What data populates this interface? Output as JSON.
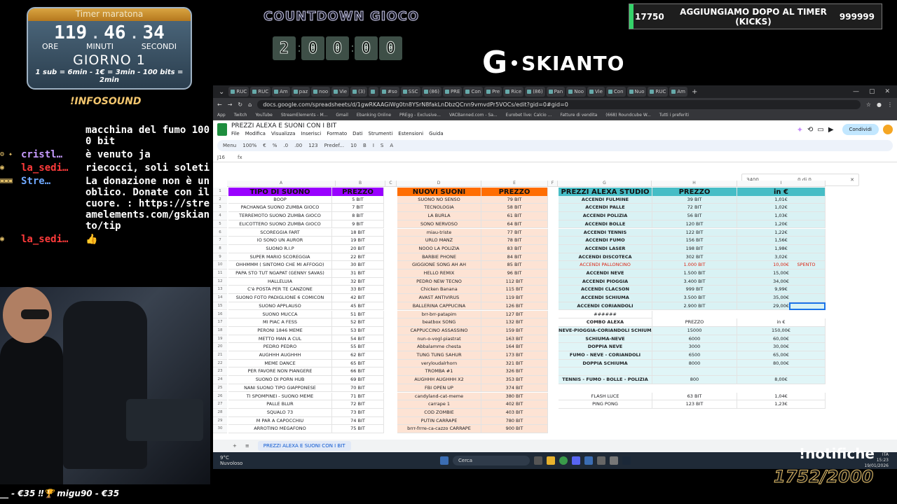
{
  "timer": {
    "title": "Timer maratona",
    "hours": "119",
    "minutes": "46",
    "seconds": "34",
    "unit_hours": "ORE",
    "unit_minutes": "MINUTI",
    "unit_seconds": "SECONDI",
    "day": "GIORNO 1",
    "rates": "1 sub = 6min - 1€ = 3min - 100 bits = 2min"
  },
  "infosound": "!INFOSOUND",
  "chat": [
    {
      "badges": "",
      "user": "",
      "color": "#ffffff",
      "msg": "macchina del fumo 1000 bit"
    },
    {
      "badges": "⚙ ✦",
      "user": "cristl…",
      "color": "#c79bff",
      "msg": "è venuto ja"
    },
    {
      "badges": "◉",
      "user": "la_sedi…",
      "color": "#ff3b3b",
      "msg": "riecocci, soli soleti"
    },
    {
      "badges": "▣▣▣",
      "user": "Stre…",
      "color": "#6fa8ff",
      "msg": "La donazione non è un oblico. Donate con il cuore. : https://streamelements.com/gskianto/tip"
    },
    {
      "badges": "◉",
      "user": "la_sedi…",
      "color": "#ff3b3b",
      "msg": "👍"
    }
  ],
  "donations": "__ - €35     ‼🏆 migu90 - €35",
  "countdown": {
    "title": "COUNTDOWN GIOCO",
    "digits": [
      "2",
      "0",
      "0",
      "0",
      "0"
    ]
  },
  "logo": {
    "letter": "G",
    "name": "SKIANTO"
  },
  "goal": {
    "current": "17750",
    "label": "AGGIUNGIAMO DOPO AL TIMER (KICKS)",
    "max": "999999",
    "progress": 0.0178
  },
  "notifiche": "!notifiche",
  "subcount": "1752/2000",
  "browser": {
    "tabs": [
      "RUC",
      "RUC",
      "Am",
      "paz",
      "noo",
      "Vie",
      "(3)",
      "",
      "#so",
      "SSC",
      "(86)",
      "PRE",
      "Con",
      "Pre",
      "Rice",
      "(86)",
      "Pan",
      "Noo",
      "Vie",
      "Con",
      "Nuo",
      "RUC",
      "Am"
    ],
    "url": "docs.google.com/spreadsheets/d/1gwRKAAGiWg0tn8YSrN8fakLnDbzQCnn9vmvdPr5VOCs/edit?gid=0#gid=0",
    "bookmarks": [
      "App",
      "Twitch",
      "YouTube",
      "StreamElements - M...",
      "Gmail",
      "Ebanking Online",
      "PREgg - Exclusive...",
      "VACBanned.com - Sa...",
      "Eurobet live: Calcio ...",
      "Fatture di vendita",
      "(668) Roundcube W...",
      "Tutti i preferiti"
    ],
    "doc_title": "PREZZI ALEXA E SUONI CON I BIT",
    "menu": [
      "File",
      "Modifica",
      "Visualizza",
      "Inserisci",
      "Formato",
      "Dati",
      "Strumenti",
      "Estensioni",
      "Guida"
    ],
    "share": "Condividi",
    "toolbar": [
      "Menu",
      "100%",
      "€",
      "%",
      ".0",
      ".00",
      "123",
      "Predef...",
      "10",
      "B",
      "I",
      "S",
      "A"
    ],
    "cell_ref": "J16",
    "find_value": "3400",
    "find_count": "0 di 0",
    "columns": [
      "A",
      "B",
      "C",
      "D",
      "E",
      "F",
      "G",
      "H",
      "I"
    ],
    "sheet_tab": "PREZZI ALEXA E SUONI CON I BIT"
  },
  "sheet": {
    "hdr1": {
      "a": "TIPO DI SUONO",
      "b": "PREZZO",
      "color": "#9900ff"
    },
    "hdr2": {
      "a": "NUOVI SUONI",
      "b": "PREZZO",
      "color": "#ff6d01"
    },
    "hdr3": {
      "a": "PREZZI ALEXA STUDIO",
      "b": "PREZZO",
      "c": "in €",
      "color": "#46bdc6"
    },
    "col1": [
      [
        "BOOP",
        "5 BIT"
      ],
      [
        "PACHANGA SUONO ZUMBA GIOCO",
        "7 BIT"
      ],
      [
        "TERREMOTO SUONO ZUMBA GIOCO",
        "8 BIT"
      ],
      [
        "ELICOTTERO SUONO ZUMBA GIOCO",
        "9 BIT"
      ],
      [
        "SCOREGGIA FART",
        "18 BIT"
      ],
      [
        "IO SONO UN AUROR",
        "19 BIT"
      ],
      [
        "SUONO R.I.P",
        "20 BIT"
      ],
      [
        "SUPER MARIO SCOREGGIA",
        "22 BIT"
      ],
      [
        "OHHMMM  ( SINTOMO CHE MI AFFOGO)",
        "30 BIT"
      ],
      [
        "PAPA STO TUT NGAPAT (GENNY SAVAS)",
        "31 BIT"
      ],
      [
        "HALLELUIA",
        "32 BIT"
      ],
      [
        "C'è POSTA PER TE CANZONE",
        "33 BIT"
      ],
      [
        "SUONO FOTO PADIGLIONE 6 COMICON",
        "42 BIT"
      ],
      [
        "SUONO APPLAUSO",
        "45 BIT"
      ],
      [
        "SUONO MUCCA",
        "51 BIT"
      ],
      [
        "MI PIAC A FESS",
        "52 BIT"
      ],
      [
        "PERONI 1846 MEME",
        "53 BIT"
      ],
      [
        "METTO MAN A CUL",
        "54 BIT"
      ],
      [
        "PEDRO PEDRO",
        "55 BIT"
      ],
      [
        "AUGHHH AUGHHH",
        "62 BIT"
      ],
      [
        "MEME DANCE",
        "65 BIT"
      ],
      [
        "PER FAVORE NON PIANGERE",
        "66 BIT"
      ],
      [
        "SUONO DI PORN HUB",
        "69 BIT"
      ],
      [
        "NANI SUONO TIPO GIAPPONESE",
        "70 BIT"
      ],
      [
        "TI SPOMPINEI - SUONO MEME",
        "71 BIT"
      ],
      [
        "PALLE BLUR",
        "72 BIT"
      ],
      [
        "SQUALO 73",
        "73 BIT"
      ],
      [
        "M PAR A CAPOCCHIU",
        "74 BIT"
      ],
      [
        "ARROTINO MEGAFONO",
        "75 BIT"
      ]
    ],
    "col2": [
      [
        "SUONO NO SENSO",
        "79 BIT"
      ],
      [
        "TECNOLOGIA",
        "58 BIT"
      ],
      [
        "LA BURLA",
        "61 BIT"
      ],
      [
        "SONO NERVOSO",
        "64 BIT"
      ],
      [
        "miau-triste",
        "77 BIT"
      ],
      [
        "URLO MANZ",
        "78 BIT"
      ],
      [
        "NOOO LA POLIZIA",
        "83 BIT"
      ],
      [
        "BARBIE PHONE",
        "84 BIT"
      ],
      [
        "GIGGIONE SONG AH AH",
        "85 BIT"
      ],
      [
        "HELLO REMIX",
        "96 BIT"
      ],
      [
        "PEDRO NEW TECNO",
        "112 BIT"
      ],
      [
        "Chicken Banana",
        "115 BIT"
      ],
      [
        "AVAST ANTIVIRUS",
        "119 BIT"
      ],
      [
        "BALLERINA CAPPUCINA",
        "126 BIT"
      ],
      [
        "brr-brr-patapim",
        "127 BIT"
      ],
      [
        "beatbox SONG",
        "132 BIT"
      ],
      [
        "CAPPUCCINO ASSASSINO",
        "159 BIT"
      ],
      [
        "nun-o-vogl-piastrat",
        "163 BIT"
      ],
      [
        "Abbalamme chesta",
        "164 BIT"
      ],
      [
        "TUNG TUNG SAHUR",
        "173 BIT"
      ],
      [
        "veryloudalrhorn",
        "321 BIT"
      ],
      [
        "TROMBA #1",
        "326 BIT"
      ],
      [
        "AUGHHH AUGHHH X2",
        "353 BIT"
      ],
      [
        "FBI OPEN UP",
        "374 BIT"
      ],
      [
        "candyland-cat-meme",
        "380 BIT"
      ],
      [
        "carrape 1",
        "402 BIT"
      ],
      [
        "COD ZOMBIE",
        "403 BIT"
      ],
      [
        "PUTIN CARRAPE",
        "780 BIT"
      ],
      [
        "brrr-frrre-ca-cazzo CARRAPE",
        "900 BIT"
      ]
    ],
    "col3": [
      [
        "ACCENDI FULMINE",
        "39 BIT",
        "1,01€"
      ],
      [
        "ACCENDI PALLE",
        "72 BIT",
        "1,02€"
      ],
      [
        "ACCENDI POLIZIA",
        "56 BIT",
        "1,03€"
      ],
      [
        "ACCENDI BOLLE",
        "120 BIT",
        "1,20€"
      ],
      [
        "ACCENDI TENNIS",
        "122 BIT",
        "1,22€"
      ],
      [
        "ACCENDI FUMO",
        "156 BIT",
        "1,56€"
      ],
      [
        "ACCENDI LASER",
        "198 BIT",
        "1,98€"
      ],
      [
        "ACCENDI DISCOTECA",
        "302 BIT",
        "3,02€"
      ],
      [
        "ACCENDI PALLONCINO",
        "1.000 BIT",
        "10,00€"
      ],
      [
        "ACCENDI NEVE",
        "1.500 BIT",
        "15,00€"
      ],
      [
        "ACCENDI PIOGGIA",
        "3.400 BIT",
        "34,00€"
      ],
      [
        "ACCENDI CLACSON",
        "999 BIT",
        "9,99€"
      ],
      [
        "ACCENDI SCHIUMA",
        "3.500 BIT",
        "35,00€"
      ],
      [
        "ACCENDI CORIANDOLI",
        "2.900 BIT",
        "29,00€"
      ]
    ],
    "spento": "SPENTO",
    "hash": "######",
    "combo_hdr": [
      "COMBO ALEXA",
      "PREZZO",
      "in €"
    ],
    "combos": [
      [
        "NEVE-PIOGGIA-CORIANDOLI SCHIUMA",
        "15000",
        "150,00€"
      ],
      [
        "SCHIUMA-NEVE",
        "6000",
        "60,00€"
      ],
      [
        "DOPPIA NEVE",
        "3000",
        "30,00€"
      ],
      [
        "FUMO - NEVE - CORIANDOLI",
        "6500",
        "65,00€"
      ],
      [
        "DOPPIA SCHIUMA",
        "8000",
        "80,00€"
      ],
      [
        "",
        "",
        " "
      ],
      [
        "TENNIS - FUMO - BOLLE - POLIZIA",
        "800",
        "8,00€"
      ]
    ],
    "extras": [
      [
        "FLASH LUCE",
        "63 BIT",
        "1,04€"
      ],
      [
        "PING PONG",
        "123 BIT",
        "1,23€"
      ]
    ]
  },
  "taskbar": {
    "temp": "9°C",
    "weather": "Nuvoloso",
    "search": "Cerca",
    "lang": "ITA",
    "time": "15:23",
    "date": "19/01/2026"
  }
}
